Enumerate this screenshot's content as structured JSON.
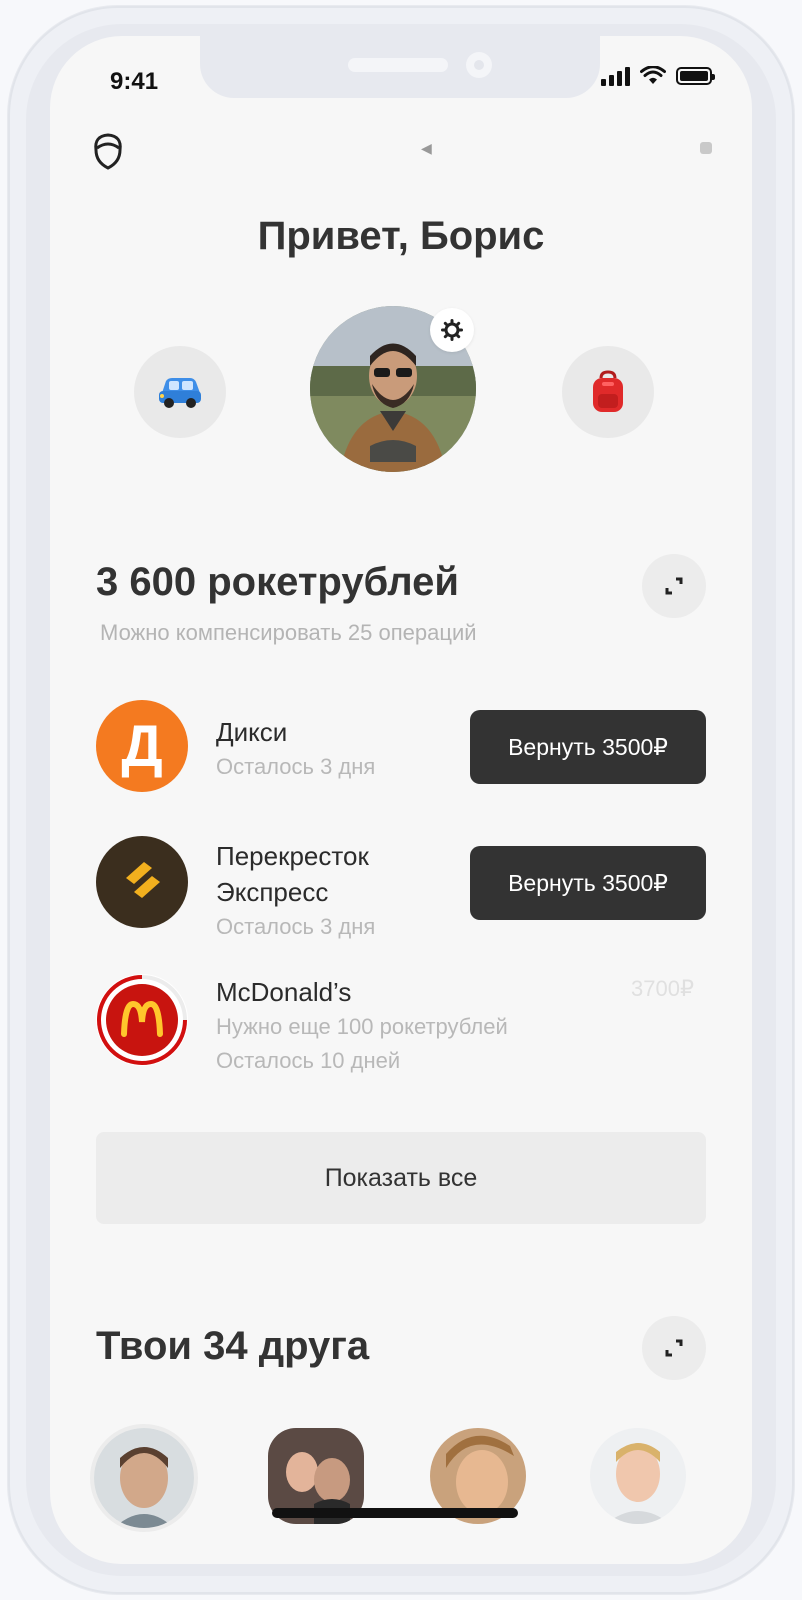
{
  "status_bar": {
    "time": "9:41"
  },
  "header": {
    "greeting": "Привет, Борис"
  },
  "icons": {
    "profile": "profile-icon",
    "car": "car-icon",
    "backpack": "backpack-icon",
    "settings": "gear-icon",
    "expand": "expand-icon"
  },
  "balance": {
    "title": "3 600 рокетрублей",
    "subtitle": "Можно компенсировать 25 операций"
  },
  "offers": [
    {
      "name": "Дикси",
      "note": "Осталось 3 дня",
      "button": "Вернуть 3500₽",
      "logo_letter": "Д",
      "logo_color": "#f47a20"
    },
    {
      "name_line1": "Перекресток",
      "name_line2": "Экспресс",
      "note": "Осталось 3 дня",
      "button": "Вернуть 3500₽",
      "logo_color": "#3b2e1e"
    },
    {
      "name": "McDonald’s",
      "note1": "Нужно еще 100 рокетрублей",
      "note2": "Осталось 10 дней",
      "price": "3700₽",
      "logo_color": "#d20f0f"
    }
  ],
  "show_all": "Показать все",
  "friends": {
    "title": "Твои 34 друга"
  },
  "colors": {
    "accent_dark": "#333333",
    "dixy_orange": "#f47a20",
    "mcd_red": "#d20f0f"
  }
}
